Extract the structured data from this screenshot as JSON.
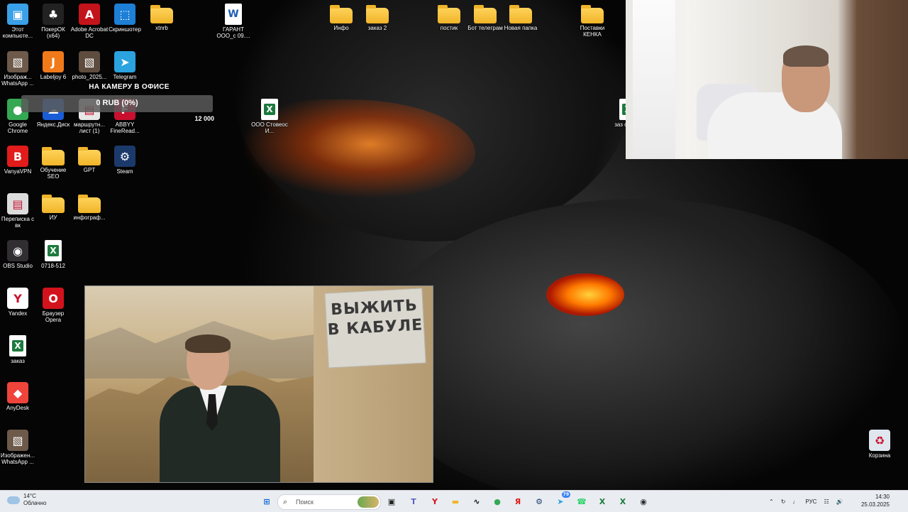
{
  "desktop": {
    "icons": [
      {
        "label": "Этот компьюте...",
        "icon": "computer-icon",
        "glyph": "▣",
        "color": "#3aa0e8"
      },
      {
        "label": "ПокерОК (x64)",
        "icon": "pokerok-icon",
        "glyph": "♣",
        "color": "#222222"
      },
      {
        "label": "Adobe Acrobat DC",
        "icon": "acrobat-icon",
        "glyph": "A",
        "color": "#c4141b"
      },
      {
        "label": "Скриншотер",
        "icon": "screenshot-icon",
        "glyph": "⬚",
        "color": "#1d7fd6"
      },
      {
        "label": "xtnrb",
        "icon": "folder-icon",
        "glyph": "",
        "color": "#f0b429"
      },
      {
        "label": "ГАРАНТ ООО_с 09....",
        "icon": "word-doc-icon",
        "glyph": "W",
        "color": "#1e5bb5"
      },
      {
        "label": "Изображ... WhatsApp ...",
        "icon": "image-file-icon",
        "glyph": "▧",
        "color": "#6d5a4a"
      },
      {
        "label": "Labeljoy 6",
        "icon": "labeljoy-icon",
        "glyph": "J",
        "color": "#f07a1a"
      },
      {
        "label": "photo_2025...",
        "icon": "photo-file-icon",
        "glyph": "▧",
        "color": "#5e4c3e"
      },
      {
        "label": "Telegram",
        "icon": "telegram-icon",
        "glyph": "➤",
        "color": "#2aa3df"
      },
      {
        "label": "Google Chrome",
        "icon": "chrome-icon",
        "glyph": "●",
        "color": "#34a853"
      },
      {
        "label": "Яндекс.Диск",
        "icon": "yandex-disk-icon",
        "glyph": "☁",
        "color": "#1a5cd6"
      },
      {
        "label": "маршрутн... лист (1)",
        "icon": "file-icon",
        "glyph": "▤",
        "color": "#e8e8e8"
      },
      {
        "label": "ABBYY FineRead...",
        "icon": "abbyy-icon",
        "glyph": "F",
        "color": "#c8102e"
      },
      {
        "label": "VanyaVPN",
        "icon": "vanyavpn-icon",
        "glyph": "B",
        "color": "#e21b1b"
      },
      {
        "label": "Обучение SEO",
        "icon": "folder-icon",
        "glyph": "",
        "color": "#f0b429"
      },
      {
        "label": "GPT",
        "icon": "folder-icon",
        "glyph": "",
        "color": "#f0b429"
      },
      {
        "label": "Steam",
        "icon": "steam-icon",
        "glyph": "⚙",
        "color": "#1b3a6b"
      },
      {
        "label": "Переписка с вк",
        "icon": "document-icon",
        "glyph": "▤",
        "color": "#dcdcdc"
      },
      {
        "label": "ИУ",
        "icon": "folder-icon",
        "glyph": "",
        "color": "#f0b429"
      },
      {
        "label": "инфограф...",
        "icon": "folder-icon",
        "glyph": "",
        "color": "#f0b429"
      },
      {
        "label": "OBS Studio",
        "icon": "obs-icon",
        "glyph": "◉",
        "color": "#302e31"
      },
      {
        "label": "0718-512",
        "icon": "excel-file-icon",
        "glyph": "X",
        "color": "#1d7a3e"
      },
      {
        "label": "Yandex",
        "icon": "yandex-browser-icon",
        "glyph": "Y",
        "color": "#ffffff"
      },
      {
        "label": "Браузер Opera",
        "icon": "opera-icon",
        "glyph": "O",
        "color": "#d3131c"
      },
      {
        "label": "заказ",
        "icon": "excel-file-icon",
        "glyph": "X",
        "color": "#1d7a3e"
      },
      {
        "label": "AnyDesk",
        "icon": "anydesk-icon",
        "glyph": "◆",
        "color": "#ef443b"
      },
      {
        "label": "Изображен... WhatsApp ...",
        "icon": "image-file-icon",
        "glyph": "▧",
        "color": "#6d5a4a"
      },
      {
        "label": "Инфо",
        "icon": "folder-icon",
        "glyph": "",
        "color": "#f0b429"
      },
      {
        "label": "заказ 2",
        "icon": "folder-icon",
        "glyph": "",
        "color": "#f0b429"
      },
      {
        "label": "постик",
        "icon": "folder-icon",
        "glyph": "",
        "color": "#f0b429"
      },
      {
        "label": "Бот телеграм",
        "icon": "folder-icon",
        "glyph": "",
        "color": "#f0b429"
      },
      {
        "label": "Новая папка",
        "icon": "folder-icon",
        "glyph": "",
        "color": "#f0b429"
      },
      {
        "label": "Поставки КЕНКА",
        "icon": "folder-icon",
        "glyph": "",
        "color": "#f0b429"
      },
      {
        "label": "ООО Стовеос И...",
        "icon": "excel-file-icon",
        "glyph": "X",
        "color": "#1d7a3e"
      },
      {
        "label": "заз сань...",
        "icon": "excel-file-icon",
        "glyph": "X",
        "color": "#1d7a3e"
      },
      {
        "label": "Корзина",
        "icon": "recycle-bin-icon",
        "glyph": "♻",
        "color": "#dfe6ee"
      }
    ]
  },
  "donation": {
    "title": "НА КАМЕРУ В ОФИСЕ",
    "progress_text": "0 RUB (0%)",
    "progress_fraction": 0,
    "goal": "12 000",
    "fill_color": "#e84c3d"
  },
  "video": {
    "sign_text": "ВЫЖИТЬ В КАБУЛЕ"
  },
  "taskbar": {
    "weather_temp": "14°C",
    "weather_desc": "Облачно",
    "search_placeholder": "Поиск",
    "apps": [
      {
        "icon": "windows-start-icon",
        "glyph": "⊞",
        "color": "#0a66d6"
      },
      {
        "icon": "task-view-icon",
        "glyph": "▣",
        "color": "#222222"
      },
      {
        "icon": "teams-icon",
        "glyph": "T",
        "color": "#5b5fc7"
      },
      {
        "icon": "yandex-browser-icon",
        "glyph": "Y",
        "color": "#d3131c"
      },
      {
        "icon": "file-explorer-icon",
        "glyph": "▬",
        "color": "#f0b429"
      },
      {
        "icon": "wave-app-icon",
        "glyph": "∿",
        "color": "#111111"
      },
      {
        "icon": "chrome-icon",
        "glyph": "●",
        "color": "#34a853"
      },
      {
        "icon": "yandex-icon",
        "glyph": "Я",
        "color": "#e21b1b"
      },
      {
        "icon": "steam-icon",
        "glyph": "⚙",
        "color": "#1b3a6b"
      },
      {
        "icon": "telegram-icon",
        "glyph": "➤",
        "color": "#2aa3df"
      },
      {
        "icon": "whatsapp-icon",
        "glyph": "☎",
        "color": "#25d366"
      },
      {
        "icon": "excel-icon",
        "glyph": "X",
        "color": "#1d7a3e"
      },
      {
        "icon": "excel-file-icon",
        "glyph": "X",
        "color": "#1d7a3e"
      },
      {
        "icon": "obs-icon",
        "glyph": "◉",
        "color": "#302e31"
      }
    ],
    "telegram_badge": "79",
    "lang": "РУС",
    "time": "14:30",
    "date": "25.03.2025"
  }
}
